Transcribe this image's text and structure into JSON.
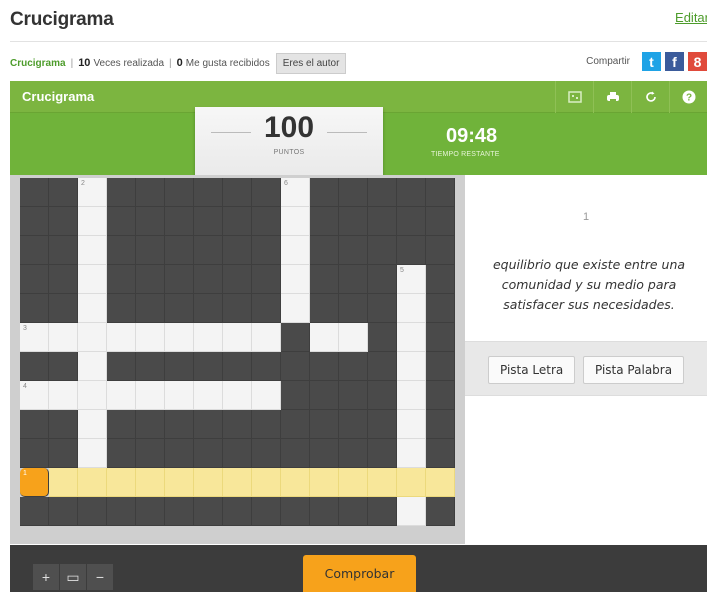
{
  "page": {
    "title": "Crucigrama",
    "edit_link": "Editar"
  },
  "stats": {
    "game_link": "Crucigrama",
    "plays_count": "10",
    "plays_label": "Veces realizada",
    "likes_count": "0",
    "likes_label": "Me gusta recibidos",
    "author_badge": "Eres el autor"
  },
  "share": {
    "label": "Compartir",
    "twitter": "t",
    "facebook": "f",
    "google": "8"
  },
  "game": {
    "title": "Crucigrama",
    "tools": [
      "fullscreen-icon",
      "print-icon",
      "restart-icon",
      "help-icon"
    ],
    "score": {
      "value": "100",
      "label": "PUNTOS"
    },
    "timer": {
      "value": "09:48",
      "label": "TIEMPO RESTANTE"
    }
  },
  "crossword": {
    "rows": 12,
    "cols": 15,
    "white_cells": [
      [
        0,
        2
      ],
      [
        1,
        2
      ],
      [
        2,
        2
      ],
      [
        3,
        2
      ],
      [
        4,
        2
      ],
      [
        5,
        2
      ],
      [
        6,
        2
      ],
      [
        7,
        2
      ],
      [
        8,
        2
      ],
      [
        9,
        2
      ],
      [
        0,
        9
      ],
      [
        1,
        9
      ],
      [
        2,
        9
      ],
      [
        3,
        9
      ],
      [
        4,
        9
      ],
      [
        3,
        13
      ],
      [
        4,
        13
      ],
      [
        5,
        13
      ],
      [
        6,
        13
      ],
      [
        7,
        13
      ],
      [
        8,
        13
      ],
      [
        9,
        13
      ],
      [
        11,
        13
      ],
      [
        5,
        0
      ],
      [
        5,
        1
      ],
      [
        5,
        3
      ],
      [
        5,
        4
      ],
      [
        5,
        5
      ],
      [
        5,
        6
      ],
      [
        5,
        7
      ],
      [
        5,
        8
      ],
      [
        5,
        10
      ],
      [
        5,
        11
      ],
      [
        7,
        0
      ],
      [
        7,
        1
      ],
      [
        7,
        3
      ],
      [
        7,
        4
      ],
      [
        7,
        5
      ],
      [
        7,
        6
      ],
      [
        7,
        7
      ],
      [
        7,
        8
      ]
    ],
    "selected_cells": [
      [
        10,
        1
      ],
      [
        10,
        2
      ],
      [
        10,
        3
      ],
      [
        10,
        4
      ],
      [
        10,
        5
      ],
      [
        10,
        6
      ],
      [
        10,
        7
      ],
      [
        10,
        8
      ],
      [
        10,
        9
      ],
      [
        10,
        10
      ],
      [
        10,
        11
      ],
      [
        10,
        12
      ],
      [
        10,
        13
      ],
      [
        10,
        14
      ]
    ],
    "active_cell": [
      10,
      0
    ],
    "numbers": [
      {
        "r": 0,
        "c": 2,
        "n": "2"
      },
      {
        "r": 0,
        "c": 9,
        "n": "6"
      },
      {
        "r": 3,
        "c": 13,
        "n": "5"
      },
      {
        "r": 5,
        "c": 0,
        "n": "3"
      },
      {
        "r": 7,
        "c": 0,
        "n": "4"
      },
      {
        "r": 10,
        "c": 0,
        "n": "1"
      }
    ]
  },
  "clue": {
    "number": "1",
    "text": "equilibrio que existe entre una comunidad y su medio para satisfacer sus necesidades."
  },
  "hints": {
    "letter": "Pista Letra",
    "word": "Pista Palabra"
  },
  "footer": {
    "zoom_in": "+",
    "zoom_fit": "▭",
    "zoom_out": "−",
    "check": "Comprobar"
  },
  "colors": {
    "accent": "#7cb540",
    "orange": "#f7a21b",
    "selected": "#f8e79a",
    "dark_cell": "#4a4a4a"
  }
}
